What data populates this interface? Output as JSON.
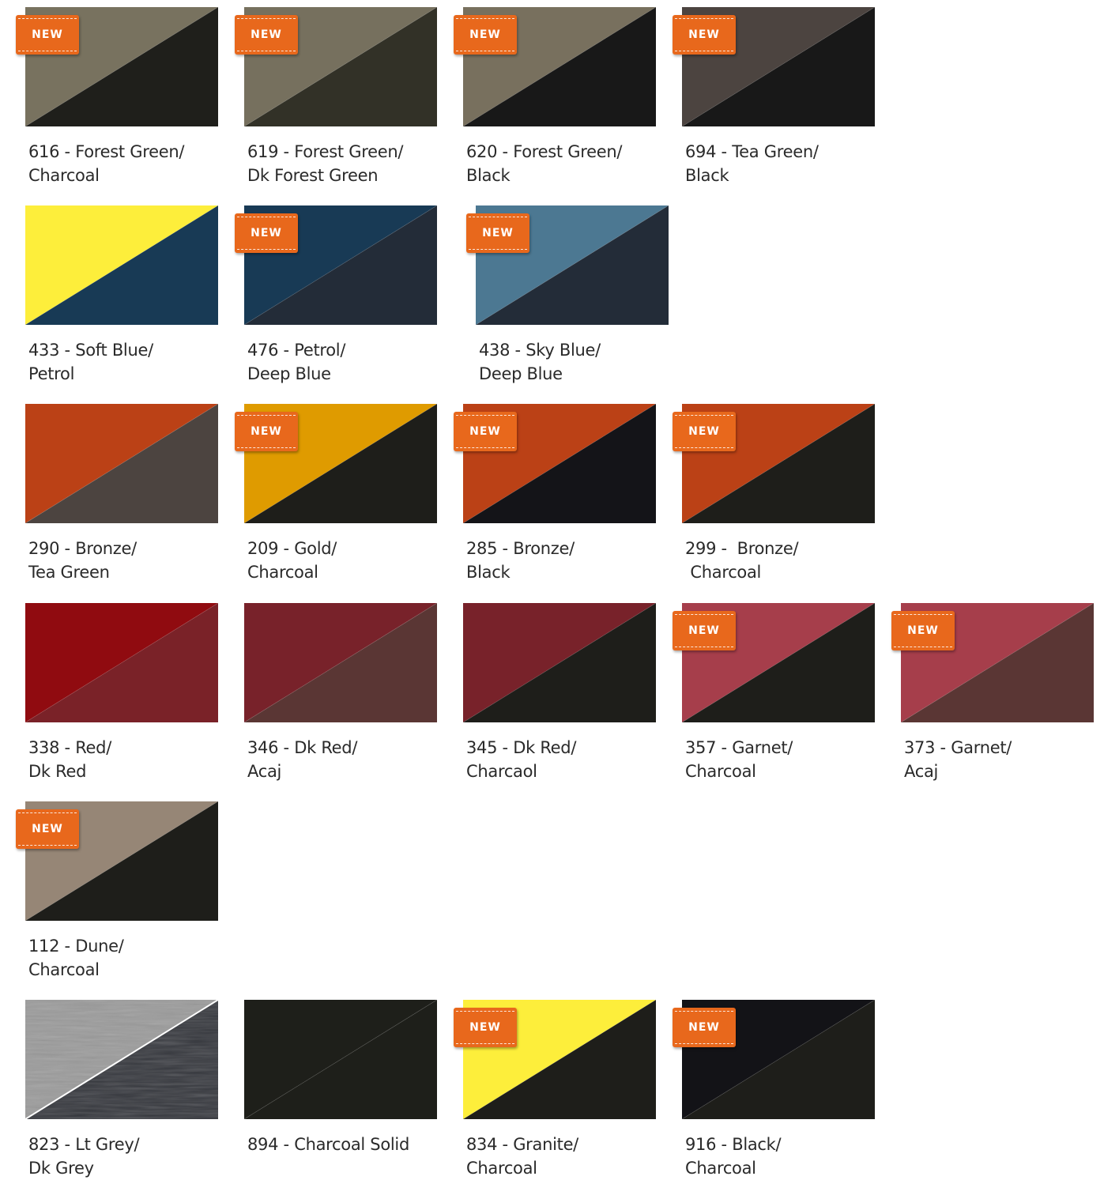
{
  "badge_label": "NEW",
  "swatches": [
    {
      "code": "616",
      "line1": "616 - Forest Green/",
      "line2": "Charcoal",
      "color_a": "#78725f",
      "color_b": "#1f1f1b",
      "is_new": true
    },
    {
      "code": "619",
      "line1": "619 - Forest Green/",
      "line2": "Dk Forest Green",
      "color_a": "#76705e",
      "color_b": "#323127",
      "is_new": true
    },
    {
      "code": "620",
      "line1": "620 - Forest Green/",
      "line2": "Black",
      "color_a": "#78705e",
      "color_b": "#181818",
      "is_new": true
    },
    {
      "code": "694",
      "line1": "694 - Tea Green/",
      "line2": "Black",
      "color_a": "#4c4440",
      "color_b": "#181818",
      "is_new": true
    },
    {
      "code": "433",
      "line1": "433 - Soft Blue/",
      "line2": "Petrol",
      "color_a": "#fdee3b",
      "color_b": "#183a55",
      "is_new": false
    },
    {
      "code": "476",
      "line1": "476 - Petrol/",
      "line2": "Deep Blue",
      "color_a": "#183a55",
      "color_b": "#232c38",
      "is_new": true
    },
    {
      "code": "438",
      "line1": "438 - Sky Blue/",
      "line2": "Deep Blue",
      "color_a": "#4c7892",
      "color_b": "#232c38",
      "is_new": true
    },
    {
      "code": "290",
      "line1": "290 - Bronze/",
      "line2": "Tea Green",
      "color_a": "#bb4116",
      "color_b": "#4c4440",
      "is_new": false
    },
    {
      "code": "209",
      "line1": "209 - Gold/",
      "line2": "Charcoal",
      "color_a": "#df9b00",
      "color_b": "#1e1e1a",
      "is_new": true
    },
    {
      "code": "285",
      "line1": "285 - Bronze/",
      "line2": "Black",
      "color_a": "#bb4116",
      "color_b": "#141418",
      "is_new": true
    },
    {
      "code": "299",
      "line1": "299 -  Bronze/",
      "line2": " Charcoal",
      "color_a": "#bb4116",
      "color_b": "#1e1e1a",
      "is_new": true
    },
    {
      "code": "338",
      "line1": "338 - Red/",
      "line2": "Dk Red",
      "color_a": "#900b10",
      "color_b": "#7a2228",
      "is_new": false
    },
    {
      "code": "346",
      "line1": "346 - Dk Red/",
      "line2": "Acaj",
      "color_a": "#78222a",
      "color_b": "#5a3634",
      "is_new": false
    },
    {
      "code": "345",
      "line1": "345 - Dk Red/",
      "line2": "Charcaol",
      "color_a": "#78222a",
      "color_b": "#1e1e1a",
      "is_new": false
    },
    {
      "code": "357",
      "line1": "357 - Garnet/",
      "line2": "Charcoal",
      "color_a": "#a63e4b",
      "color_b": "#1e1e1a",
      "is_new": true
    },
    {
      "code": "373",
      "line1": "373 - Garnet/",
      "line2": "Acaj",
      "color_a": "#a63e4b",
      "color_b": "#5a3634",
      "is_new": true
    },
    {
      "code": "112",
      "line1": "112 - Dune/",
      "line2": "Charcoal",
      "color_a": "#968676",
      "color_b": "#1e1e1a",
      "is_new": true
    },
    {
      "code": "823",
      "line1": "823 - Lt Grey/",
      "line2": "Dk Grey",
      "color_a": "#9a9a9a",
      "color_b": "#34363c",
      "is_new": false,
      "heather": true
    },
    {
      "code": "894",
      "line1": "894 - Charcoal Solid",
      "line2": "",
      "color_a": "#1e1f1a",
      "color_b": "#1e1f1a",
      "is_new": false
    },
    {
      "code": "834",
      "line1": "834 - Granite/",
      "line2": "Charcoal",
      "color_a": "#fdee3b",
      "color_b": "#1e1e1a",
      "is_new": true
    },
    {
      "code": "916",
      "line1": "916 - Black/",
      "line2": "Charcoal",
      "color_a": "#131317",
      "color_b": "#1e1e1a",
      "is_new": true
    }
  ]
}
